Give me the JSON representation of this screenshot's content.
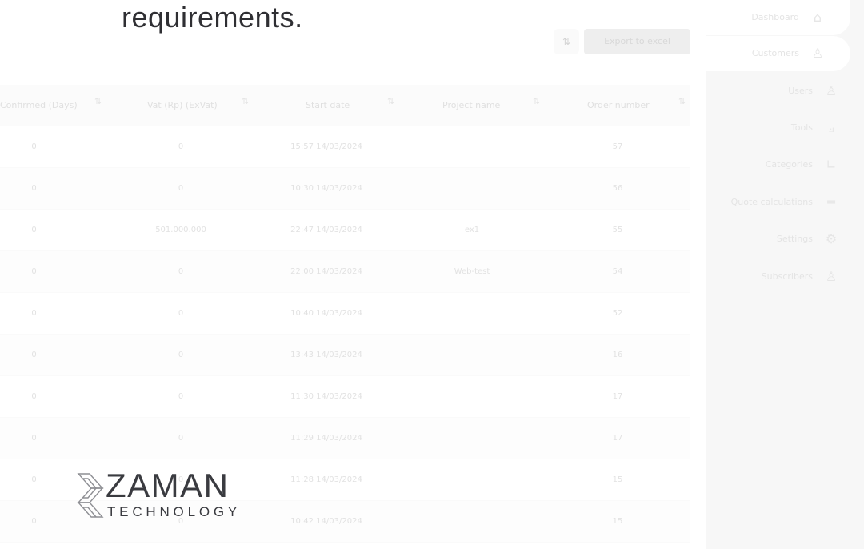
{
  "overlay": {
    "text": "requirements."
  },
  "toolbar": {
    "filter_icon": "filter-icon",
    "export_label": "Export to excel"
  },
  "table": {
    "columns": [
      "Confirmed (Days)",
      "Vat (Rp) (ExVat)",
      "Start date",
      "Project name",
      "Order number"
    ],
    "rows": [
      [
        "0",
        "0",
        "15:57 14/03/2024",
        "",
        "57"
      ],
      [
        "0",
        "0",
        "10:30 14/03/2024",
        "",
        "56"
      ],
      [
        "0",
        "501.000.000",
        "22:47 14/03/2024",
        "ex1",
        "55"
      ],
      [
        "0",
        "0",
        "22:00 14/03/2024",
        "Web-test",
        "54"
      ],
      [
        "0",
        "0",
        "10:40 14/03/2024",
        "",
        "52"
      ],
      [
        "0",
        "0",
        "13:43 14/03/2024",
        "",
        "16"
      ],
      [
        "0",
        "0",
        "11:30 14/03/2024",
        "",
        "17"
      ],
      [
        "0",
        "0",
        "11:29 14/03/2024",
        "",
        "17"
      ],
      [
        "0",
        "0",
        "11:28 14/03/2024",
        "",
        "15"
      ],
      [
        "0",
        "0",
        "10:42 14/03/2024",
        "",
        "15"
      ]
    ]
  },
  "sidebar": {
    "items": [
      {
        "label": "Dashboard",
        "icon": "home-icon"
      },
      {
        "label": "Customers",
        "icon": "users-icon"
      },
      {
        "label": "Users",
        "icon": "user-icon"
      },
      {
        "label": "Tools",
        "icon": "tools-icon"
      },
      {
        "label": "Categories",
        "icon": "categories-icon"
      },
      {
        "label": "Quote calculations",
        "icon": "list-icon"
      },
      {
        "label": "Settings",
        "icon": "gear-icon"
      },
      {
        "label": "Subscribers",
        "icon": "subscriber-icon"
      }
    ]
  },
  "logo": {
    "word": "ZAMAN",
    "sub": "TECHNOLOGY"
  }
}
